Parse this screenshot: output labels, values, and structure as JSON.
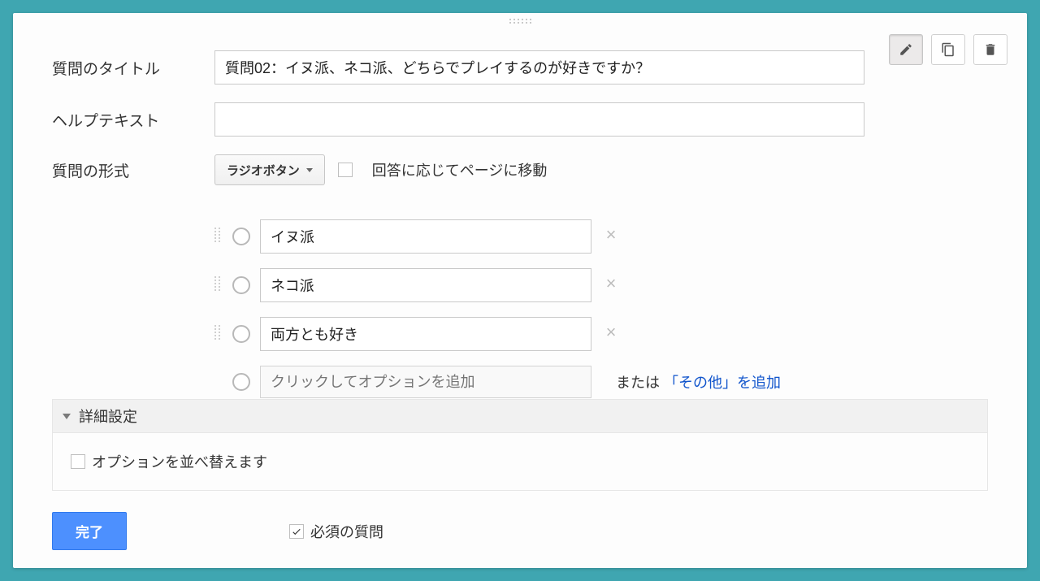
{
  "labels": {
    "question_title": "質問のタイトル",
    "help_text": "ヘルプテキスト",
    "question_type": "質問の形式"
  },
  "values": {
    "title": "質問02：イヌ派、ネコ派、どちらでプレイするのが好きですか？",
    "help": ""
  },
  "type": {
    "selected": "ラジオボタン",
    "goto_page_label": "回答に応じてページに移動",
    "goto_page_checked": false
  },
  "options": [
    {
      "text": "イヌ派"
    },
    {
      "text": "ネコ派"
    },
    {
      "text": "両方とも好き"
    }
  ],
  "add_option_placeholder": "クリックしてオプションを追加",
  "or_other": {
    "prefix": "または",
    "link": "「その他」を追加"
  },
  "advanced": {
    "title": "詳細設定",
    "shuffle_label": "オプションを並べ替えます",
    "shuffle_checked": false
  },
  "footer": {
    "done": "完了",
    "required_label": "必須の質問",
    "required_checked": true
  },
  "icons": {
    "edit": "edit-icon",
    "duplicate": "duplicate-icon",
    "delete": "delete-icon"
  }
}
